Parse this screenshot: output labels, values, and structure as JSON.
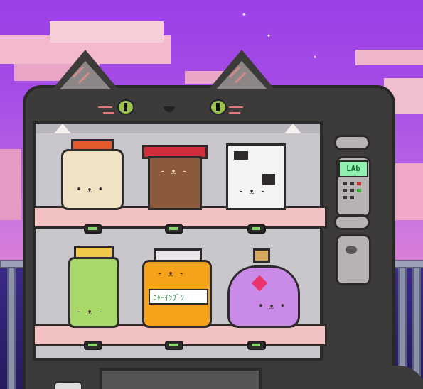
{
  "machine": {
    "panel_screen_label": "LAb",
    "top_shelf_items": [
      {
        "name": "milky-cat-jar",
        "face": "• ᴥ •"
      },
      {
        "name": "tabby-cat-cup",
        "face": "- ᴥ -"
      },
      {
        "name": "cow-cat-carton",
        "face": "- ᴥ -"
      }
    ],
    "bottom_shelf_items": [
      {
        "name": "green-leaf-cat-jar",
        "face": "- ᴥ -"
      },
      {
        "name": "orange-cat-jar",
        "face": "- ᴥ -"
      },
      {
        "name": "purple-potion-cat",
        "face": "• ᴥ •"
      }
    ],
    "orange_jar_label": "ﾆｬｰｲﾝﾌﾞﾝ"
  },
  "colors": {
    "sky_top": "#9a3fe6",
    "machine_body": "#3d3a3a",
    "shelf": "#f2c2c2",
    "screen": "#8ff0b0"
  }
}
